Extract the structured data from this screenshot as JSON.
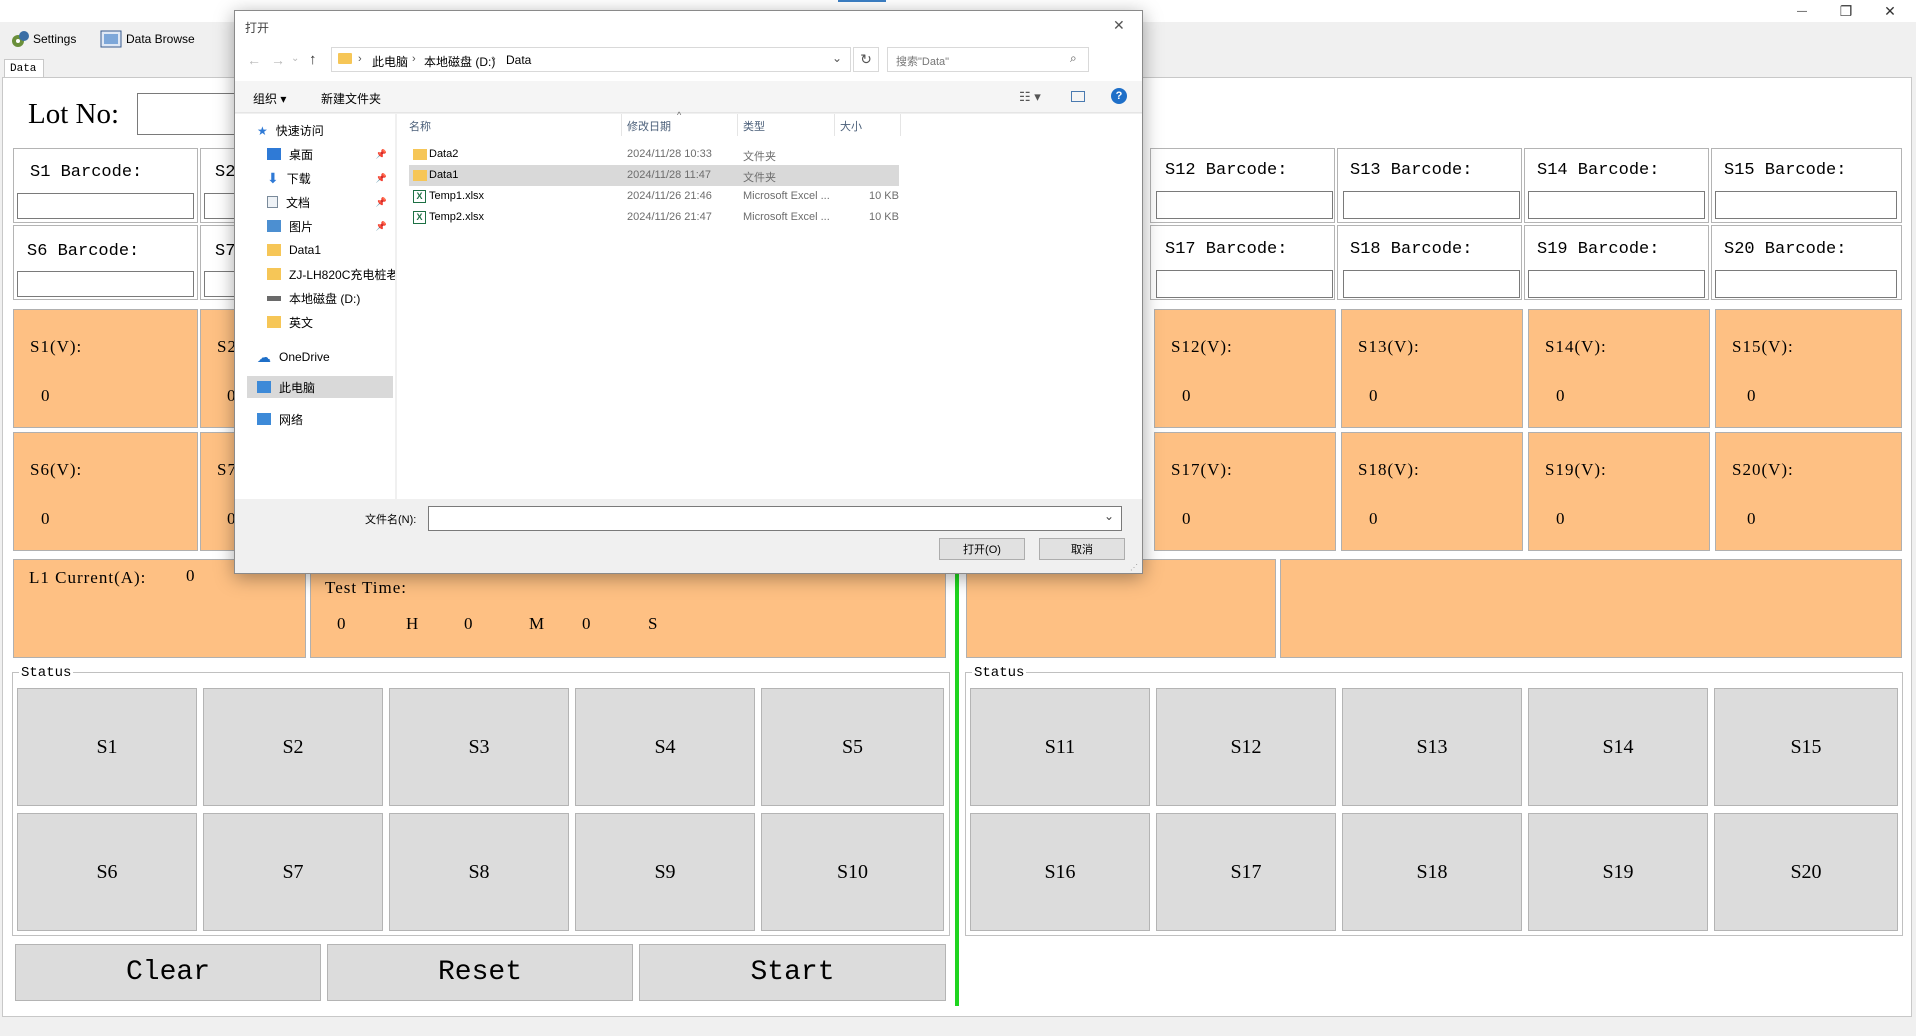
{
  "window": {
    "minimize": "—",
    "restore": "❐",
    "close": "✕"
  },
  "toolbar": {
    "settings": "Settings",
    "data_browse": "Data Browse"
  },
  "tab": {
    "data": "Data"
  },
  "lot": {
    "label": "Lot No:"
  },
  "barcodes": {
    "s1": "S1 Barcode:",
    "s2": "S2",
    "s6": "S6 Barcode:",
    "s7": "S7",
    "s12": "S12 Barcode:",
    "s13": "S13 Barcode:",
    "s14": "S14 Barcode:",
    "s15": "S15 Barcode:",
    "s17": "S17 Barcode:",
    "s18": "S18 Barcode:",
    "s19": "S19 Barcode:",
    "s20": "S20 Barcode:"
  },
  "voltages": {
    "s1": {
      "label": "S1(V):",
      "value": "0"
    },
    "s2": {
      "label": "S2",
      "value": "0"
    },
    "s6": {
      "label": "S6(V):",
      "value": "0"
    },
    "s7": {
      "label": "S7",
      "value": "0"
    },
    "s12": {
      "label": "S12(V):",
      "value": "0"
    },
    "s13": {
      "label": "S13(V):",
      "value": "0"
    },
    "s14": {
      "label": "S14(V):",
      "value": "0"
    },
    "s15": {
      "label": "S15(V):",
      "value": "0"
    },
    "s17": {
      "label": "S17(V):",
      "value": "0"
    },
    "s18": {
      "label": "S18(V):",
      "value": "0"
    },
    "s19": {
      "label": "S19(V):",
      "value": "0"
    },
    "s20": {
      "label": "S20(V):",
      "value": "0"
    }
  },
  "current": {
    "label": "L1 Current(A):",
    "value": "0"
  },
  "test_time": {
    "label": "Test Time:",
    "h": "0",
    "h_unit": "H",
    "m": "0",
    "m_unit": "M",
    "s": "0",
    "s_unit": "S"
  },
  "status_left": {
    "title": "Status",
    "items": [
      "S1",
      "S2",
      "S3",
      "S4",
      "S5",
      "S6",
      "S7",
      "S8",
      "S9",
      "S10"
    ]
  },
  "status_right": {
    "title": "Status",
    "items": [
      "S11",
      "S12",
      "S13",
      "S14",
      "S15",
      "S16",
      "S17",
      "S18",
      "S19",
      "S20"
    ]
  },
  "actions": {
    "clear": "Clear",
    "reset": "Reset",
    "start": "Start"
  },
  "dialog": {
    "title": "打开",
    "close": "✕",
    "path": {
      "pc": "此电脑",
      "drive": "本地磁盘 (D:)",
      "folder": "Data"
    },
    "search_placeholder": "搜索\"Data\"",
    "organize": "组织 ▾",
    "new_folder": "新建文件夹",
    "help": "?",
    "tree": [
      "快速访问",
      "桌面",
      "下载",
      "文档",
      "图片",
      "Data1",
      "ZJ-LH820C充电桩老",
      "本地磁盘 (D:)",
      "英文",
      "OneDrive",
      "此电脑",
      "网络"
    ],
    "columns": {
      "name": "名称",
      "date": "修改日期",
      "type": "类型",
      "size": "大小"
    },
    "files": [
      {
        "name": "Data2",
        "date": "2024/11/28 10:33",
        "type": "文件夹",
        "size": ""
      },
      {
        "name": "Data1",
        "date": "2024/11/28 11:47",
        "type": "文件夹",
        "size": ""
      },
      {
        "name": "Temp1.xlsx",
        "date": "2024/11/26 21:46",
        "type": "Microsoft Excel ...",
        "size": "10 KB"
      },
      {
        "name": "Temp2.xlsx",
        "date": "2024/11/26 21:47",
        "type": "Microsoft Excel ...",
        "size": "10 KB"
      }
    ],
    "filename_label": "文件名(N):",
    "filename_value": "",
    "open": "打开(O)",
    "cancel": "取消"
  }
}
